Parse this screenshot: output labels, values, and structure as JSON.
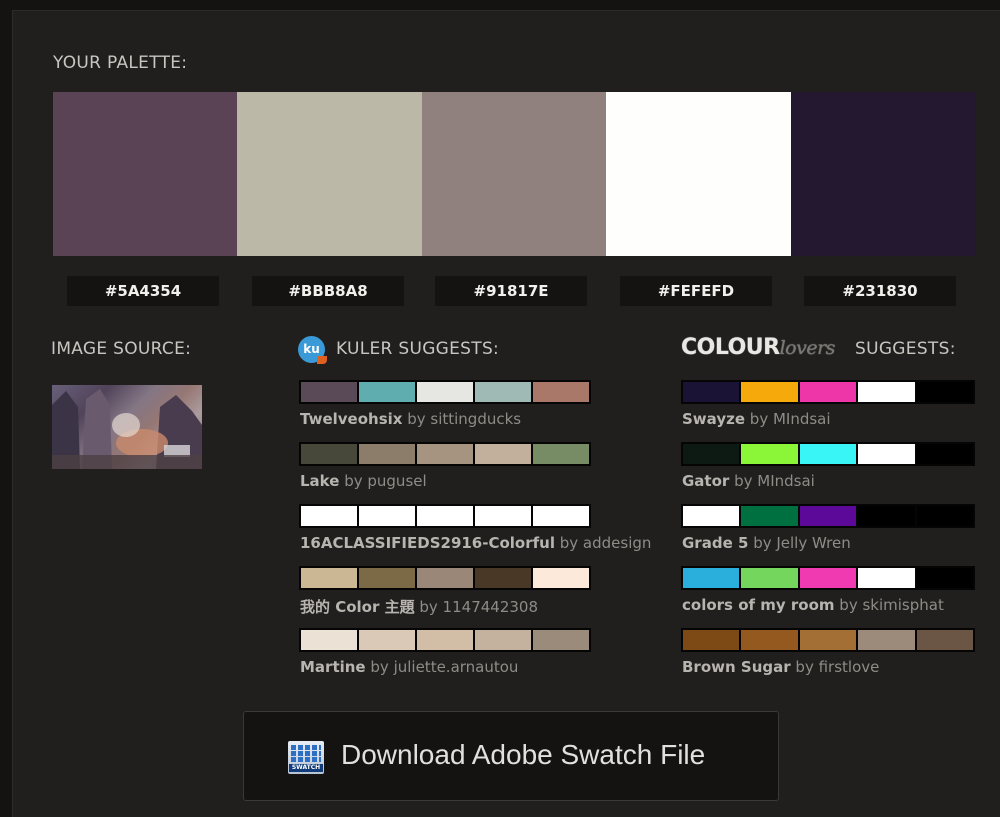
{
  "palette": {
    "heading": "YOUR PALETTE:",
    "swatches": [
      {
        "hex": "#5A4354",
        "color": "#5A4354"
      },
      {
        "hex": "#BBB8A8",
        "color": "#BBB8A8"
      },
      {
        "hex": "#91817E",
        "color": "#91817E"
      },
      {
        "hex": "#FEFEFD",
        "color": "#FEFEFD"
      },
      {
        "hex": "#231830",
        "color": "#231830"
      }
    ]
  },
  "image_source": {
    "heading": "IMAGE SOURCE:"
  },
  "kuler": {
    "logo_text": "ku",
    "heading": "KULER SUGGESTS:",
    "suggestions": [
      {
        "name": "Twelveohsix",
        "by": "by sittingducks",
        "colors": [
          "#5a4a58",
          "#5fadaf",
          "#e6e7e3",
          "#9fb9b5",
          "#a97868"
        ]
      },
      {
        "name": "Lake",
        "by": "by pugusel",
        "colors": [
          "#48483a",
          "#8c7d6b",
          "#a69380",
          "#c2b09c",
          "#778c64"
        ]
      },
      {
        "name": "16ACLASSIFIEDS2916-Colorful",
        "by": "by addesign",
        "colors": [
          "#ffffff",
          "#ffffff",
          "#ffffff",
          "#ffffff",
          "#ffffff"
        ]
      },
      {
        "name": "我的 Color 主題",
        "by": "by 1147442308",
        "colors": [
          "#cbb794",
          "#7c6a46",
          "#9b8778",
          "#4a3827",
          "#fde9d9"
        ]
      },
      {
        "name": "Martine",
        "by": "by juliette.arnautou",
        "colors": [
          "#ece1d5",
          "#dac9b7",
          "#d2bea6",
          "#c4b19e",
          "#9a8b7b"
        ]
      }
    ]
  },
  "colourlovers": {
    "logo_bold": "COLOUR",
    "logo_light": "lovers",
    "heading": "SUGGESTS:",
    "suggestions": [
      {
        "name": "Swayze",
        "by": "by MIndsai",
        "colors": [
          "#1a1335",
          "#f6a90b",
          "#ef36a8",
          "#ffffff",
          "#000000"
        ]
      },
      {
        "name": "Gator",
        "by": "by MIndsai",
        "colors": [
          "#0c1a13",
          "#8bf537",
          "#39f5f5",
          "#ffffff",
          "#000000"
        ]
      },
      {
        "name": "Grade 5",
        "by": "by Jelly Wren",
        "colors": [
          "#ffffff",
          "#007040",
          "#5c0898",
          "#000000",
          "#000000"
        ]
      },
      {
        "name": "colors of my room",
        "by": "by skimisphat",
        "colors": [
          "#2aaedb",
          "#74d65d",
          "#ef3ab2",
          "#ffffff",
          "#000000"
        ]
      },
      {
        "name": "Brown Sugar",
        "by": "by firstlove",
        "colors": [
          "#7d4915",
          "#93591f",
          "#a46f34",
          "#9c8b7b",
          "#6b5645"
        ]
      }
    ]
  },
  "download": {
    "label": "Download Adobe Swatch File",
    "icon_label": "SWATCH"
  }
}
